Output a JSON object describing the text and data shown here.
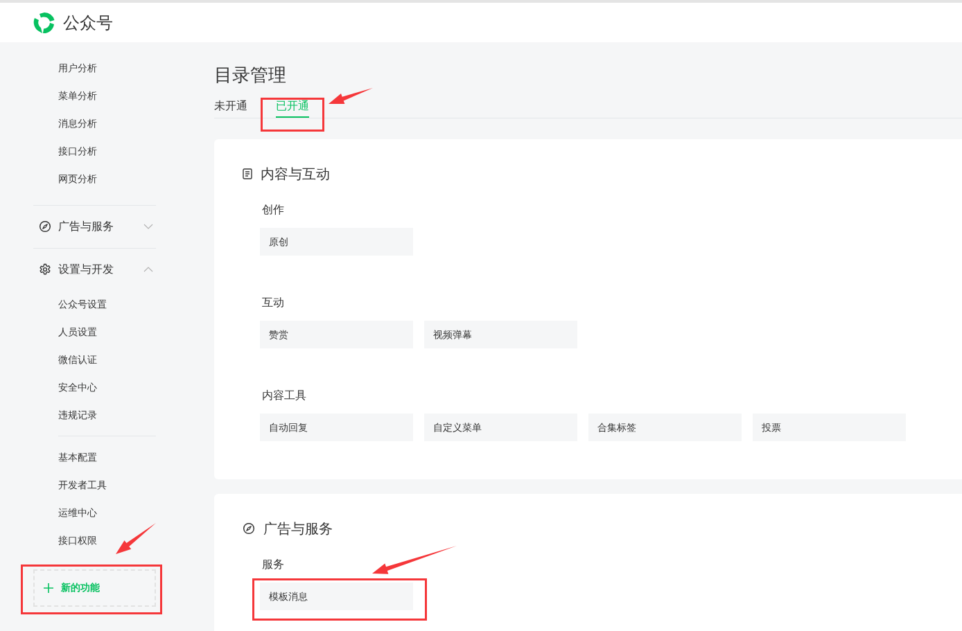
{
  "header": {
    "title": "公众号"
  },
  "sidebar": {
    "sections": [
      {
        "kind": "links",
        "items": [
          "用户分析",
          "菜单分析",
          "消息分析",
          "接口分析",
          "网页分析"
        ]
      },
      {
        "kind": "group",
        "label": "广告与服务",
        "expanded": false
      },
      {
        "kind": "group",
        "label": "设置与开发",
        "expanded": true,
        "children": [
          {
            "items": [
              "公众号设置",
              "人员设置",
              "微信认证",
              "安全中心",
              "违规记录"
            ]
          },
          {
            "items": [
              "基本配置",
              "开发者工具",
              "运维中心",
              "接口权限"
            ]
          }
        ]
      }
    ],
    "new_feature": {
      "label": "新的功能"
    }
  },
  "page": {
    "title": "目录管理",
    "tabs": [
      {
        "label": "未开通",
        "selected": false
      },
      {
        "label": "已开通",
        "selected": true
      }
    ],
    "cards": [
      {
        "title": "内容与互动",
        "groups": [
          {
            "title": "创作",
            "items": [
              "原创"
            ]
          },
          {
            "title": "互动",
            "items": [
              "赞赏",
              "视频弹幕"
            ]
          },
          {
            "title": "内容工具",
            "items": [
              "自动回复",
              "自定义菜单",
              "合集标签",
              "投票"
            ]
          }
        ]
      },
      {
        "title": "广告与服务",
        "groups": [
          {
            "title": "服务",
            "items": [
              "模板消息"
            ]
          }
        ]
      }
    ]
  }
}
